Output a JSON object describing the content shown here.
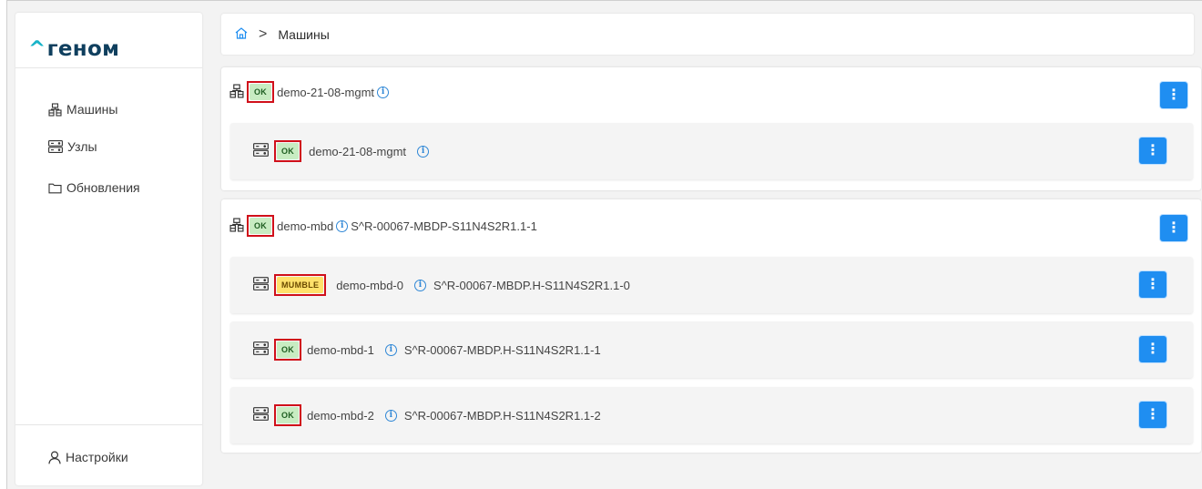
{
  "brand": {
    "caret": "^",
    "name": "геном",
    "accent": "#17b3c8",
    "color": "#0f3f5e"
  },
  "sidebar": {
    "items": [
      {
        "label": "Машины",
        "icon": "machines-icon"
      },
      {
        "label": "Узлы",
        "icon": "server-icon"
      },
      {
        "label": "Обновления",
        "icon": "folder-icon"
      }
    ],
    "settings": {
      "label": "Настройки",
      "icon": "user-icon"
    }
  },
  "breadcrumb": {
    "home_icon": "home-icon",
    "separator": ">",
    "current": "Машины"
  },
  "cards": [
    {
      "status": "OK",
      "name": "demo-21-08-mgmt",
      "serial": "",
      "nodes": [
        {
          "status": "OK",
          "name": "demo-21-08-mgmt",
          "serial": ""
        }
      ]
    },
    {
      "status": "OK",
      "name": "demo-mbd",
      "serial": "S^R-00067-MBDP-S11N4S2R1.1-1",
      "nodes": [
        {
          "status": "MUMBLE",
          "name": "demo-mbd-0",
          "serial": "S^R-00067-MBDP.H-S11N4S2R1.1-0"
        },
        {
          "status": "OK",
          "name": "demo-mbd-1",
          "serial": "S^R-00067-MBDP.H-S11N4S2R1.1-1"
        },
        {
          "status": "OK",
          "name": "demo-mbd-2",
          "serial": "S^R-00067-MBDP.H-S11N4S2R1.1-2"
        }
      ]
    }
  ],
  "menu_glyph": "⋮",
  "info_glyph": "i",
  "colors": {
    "ok_bg": "#c8ecc2",
    "mumble_bg": "#ffe16b",
    "button": "#1f8ef1",
    "highlight_border": "#d0101a"
  }
}
